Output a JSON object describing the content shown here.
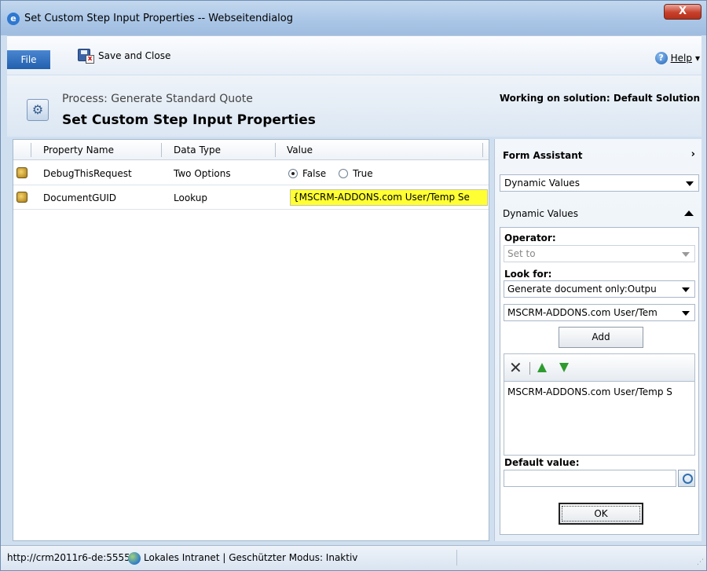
{
  "window": {
    "title": "Set Custom Step Input Properties -- Webseitendialog",
    "close_label": "X"
  },
  "ribbon": {
    "file_label": "File",
    "save_close_label": "Save and Close",
    "help_label": "Help",
    "help_caret": "▾"
  },
  "header": {
    "process_line": "Process: Generate Standard Quote",
    "page_title": "Set Custom Step Input Properties",
    "solution": "Working on solution: Default Solution"
  },
  "grid": {
    "columns": [
      "Property Name",
      "Data Type",
      "Value"
    ],
    "rows": [
      {
        "name": "DebugThisRequest",
        "type": "Two Options",
        "options": [
          "False",
          "True"
        ],
        "selected": "False"
      },
      {
        "name": "DocumentGUID",
        "type": "Lookup",
        "value": "{MSCRM-ADDONS.com User/Temp Se"
      }
    ]
  },
  "form_assistant": {
    "title": "Form Assistant",
    "chevron": "›",
    "mode_select": "Dynamic Values",
    "section_title": "Dynamic Values",
    "operator_label": "Operator:",
    "operator_value": "Set to",
    "look_for_label": "Look for:",
    "look_for_value": "Generate document only:Outpu",
    "entity_value": "MSCRM-ADDONS.com User/Tem",
    "add_label": "Add",
    "delete_glyph": "✕",
    "selected_value": "MSCRM-ADDONS.com User/Temp S",
    "default_value_label": "Default value:",
    "default_value": "",
    "ok_label": "OK"
  },
  "status": {
    "url": "http://crm2011r6-de:5555",
    "zone": "Lokales Intranet | Geschützter Modus: Inaktiv"
  },
  "colors": {
    "lookup_highlight": "#ffff33",
    "file_button": "#2f6dbd",
    "arrow_green": "#2e9b2e"
  }
}
